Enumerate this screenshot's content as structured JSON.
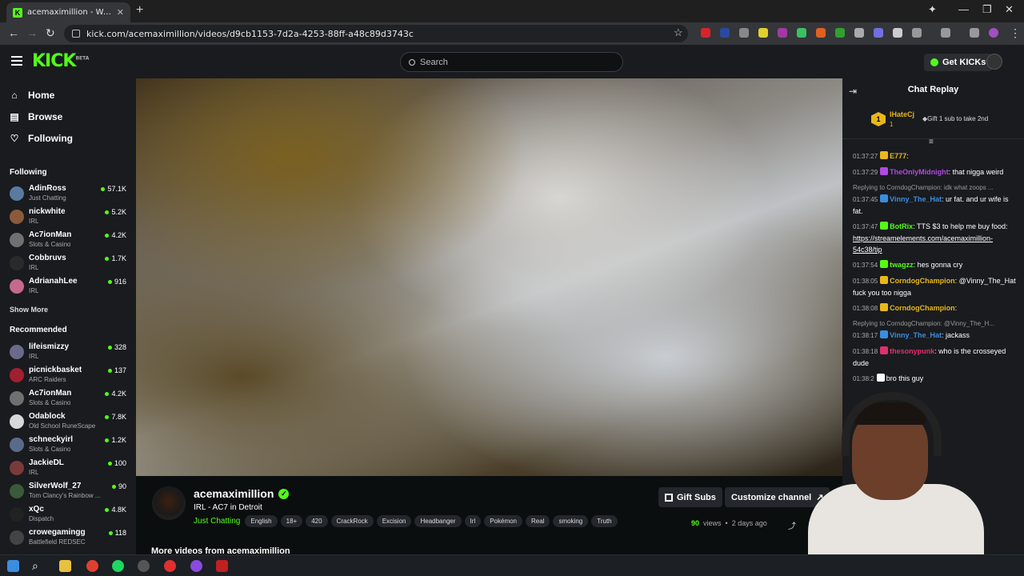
{
  "browser": {
    "tab_title": "acemaximillion - Watch the",
    "url": "kick.com/acemaximillion/videos/d9cb1153-7d2a-4253-88ff-a48c89d3743c"
  },
  "header": {
    "logo": "KICK",
    "logo_beta": "BETA",
    "search_placeholder": "Search",
    "get_kicks": "Get KICKs"
  },
  "sidebar": {
    "nav": [
      {
        "label": "Home",
        "icon": "home-icon"
      },
      {
        "label": "Browse",
        "icon": "browse-icon"
      },
      {
        "label": "Following",
        "icon": "heart-icon"
      }
    ],
    "following_title": "Following",
    "following": [
      {
        "name": "AdinRoss",
        "category": "Just Chatting",
        "viewers": "57.1K",
        "color": "#5a7aa0"
      },
      {
        "name": "nickwhite",
        "category": "IRL",
        "viewers": "5.2K",
        "color": "#8a5a3a"
      },
      {
        "name": "Ac7ionMan",
        "category": "Slots & Casino",
        "viewers": "4.2K",
        "color": "#707070"
      },
      {
        "name": "Cobbruvs",
        "category": "IRL",
        "viewers": "1.7K",
        "color": "#2a2a2a"
      },
      {
        "name": "AdrianahLee",
        "category": "IRL",
        "viewers": "916",
        "color": "#c46a8a"
      }
    ],
    "show_more": "Show More",
    "recommended_title": "Recommended",
    "recommended": [
      {
        "name": "lifeismizzy",
        "category": "IRL",
        "viewers": "328",
        "color": "#6a6a8a"
      },
      {
        "name": "picnickbasket",
        "category": "ARC Raiders",
        "viewers": "137",
        "color": "#a02030"
      },
      {
        "name": "Ac7ionMan",
        "category": "Slots & Casino",
        "viewers": "4.2K",
        "color": "#707070"
      },
      {
        "name": "Odablock",
        "category": "Old School RuneScape",
        "viewers": "7.8K",
        "color": "#d8d8d8"
      },
      {
        "name": "schneckyirl",
        "category": "Slots & Casino",
        "viewers": "1.2K",
        "color": "#5a6a8a"
      },
      {
        "name": "JackieDL",
        "category": "IRL",
        "viewers": "100",
        "color": "#7a3a3a"
      },
      {
        "name": "SilverWolf_27",
        "category": "Tom Clancy's Rainbow ...",
        "viewers": "90",
        "color": "#3a5a3a"
      },
      {
        "name": "xQc",
        "category": "Dispatch",
        "viewers": "4.8K",
        "color": "#222222"
      },
      {
        "name": "crowegamingg",
        "category": "Battlefield REDSEC",
        "viewers": "118",
        "color": "#444444"
      }
    ]
  },
  "video": {
    "channel_name": "acemaximillion",
    "title": "IRL - AC7 in Detroit",
    "category": "Just Chatting",
    "tags": [
      "English",
      "18+",
      "420",
      "CrackRock",
      "Excision",
      "Headbanger",
      "Irl",
      "Pokémon",
      "Real",
      "smoking",
      "Truth"
    ],
    "gift_subs": "Gift Subs",
    "customize": "Customize channel",
    "views": "90",
    "views_label": "views",
    "age": "2 days ago",
    "more_videos": "More videos from acemaximillion"
  },
  "chat": {
    "title": "Chat Replay",
    "pinned": {
      "rank": "1",
      "name": "IHateCj",
      "count": "1",
      "text": "Gift 1 sub to take 2nd"
    },
    "messages": [
      {
        "ts": "01:37:27",
        "user": "E777",
        "color": "#e8b71a",
        "text": ""
      },
      {
        "ts": "01:37:29",
        "user": "TheOnlyMidnight",
        "color": "#b04ae0",
        "text": "that nigga weird"
      },
      {
        "ts": "01:37:45",
        "user": "Vinny_The_Hat",
        "color": "#3a8de0",
        "reply": "Replying to CorndogChampion: idk what zoops ...",
        "text": "ur fat. and ur wife is fat."
      },
      {
        "ts": "01:37:47",
        "user": "BotRix",
        "color": "#53fc18",
        "text": "TTS $3 to help me buy food:",
        "link": "https://streamelements.com/acemaximillion-54c38/tip"
      },
      {
        "ts": "01:37:54",
        "user": "twagzz",
        "color": "#53fc18",
        "text": "hes gonna cry"
      },
      {
        "ts": "01:38:05",
        "user": "CorndogChampion",
        "color": "#e8b71a",
        "text": "@Vinny_The_Hat fuck you too nigga"
      },
      {
        "ts": "01:38:08",
        "user": "CorndogChampion",
        "color": "#e8b71a",
        "text": ""
      },
      {
        "ts": "01:38:17",
        "user": "Vinny_The_Hat",
        "color": "#3a8de0",
        "reply": "Replying to CorndogChampion: @Vinny_The_H...",
        "text": "jackass"
      },
      {
        "ts": "01:38:18",
        "user": "thesonypunk",
        "color": "#e0306a",
        "text": "who is the crosseyed dude"
      },
      {
        "ts": "01:38:2",
        "user": "",
        "color": "#ffffff",
        "text": "bro this guy"
      }
    ]
  },
  "colors": {
    "accent": "#53fc18",
    "panel": "#191b1f",
    "page": "#0b0e0f"
  }
}
